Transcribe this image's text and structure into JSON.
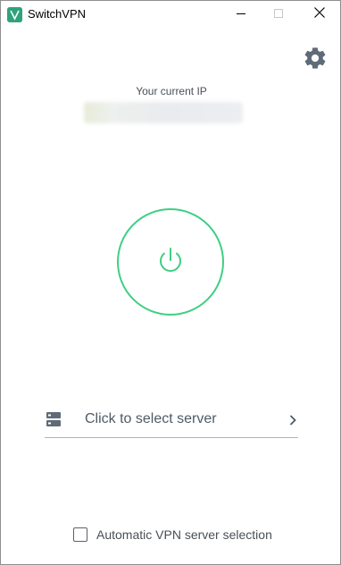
{
  "window": {
    "title": "SwitchVPN",
    "minimize_icon": "minimize-icon",
    "maximize_icon": "maximize-icon",
    "close_icon": "close-icon"
  },
  "settings": {
    "icon": "gear-icon"
  },
  "ip": {
    "label": "Your current IP",
    "value": "",
    "value_obscured": true
  },
  "connect": {
    "icon": "power-icon",
    "ring_color": "#3fcf83"
  },
  "server": {
    "icon": "server-icon",
    "label": "Click to select server",
    "chevron_icon": "chevron-right-icon"
  },
  "auto_select": {
    "label": "Automatic VPN server selection",
    "checked": false
  }
}
